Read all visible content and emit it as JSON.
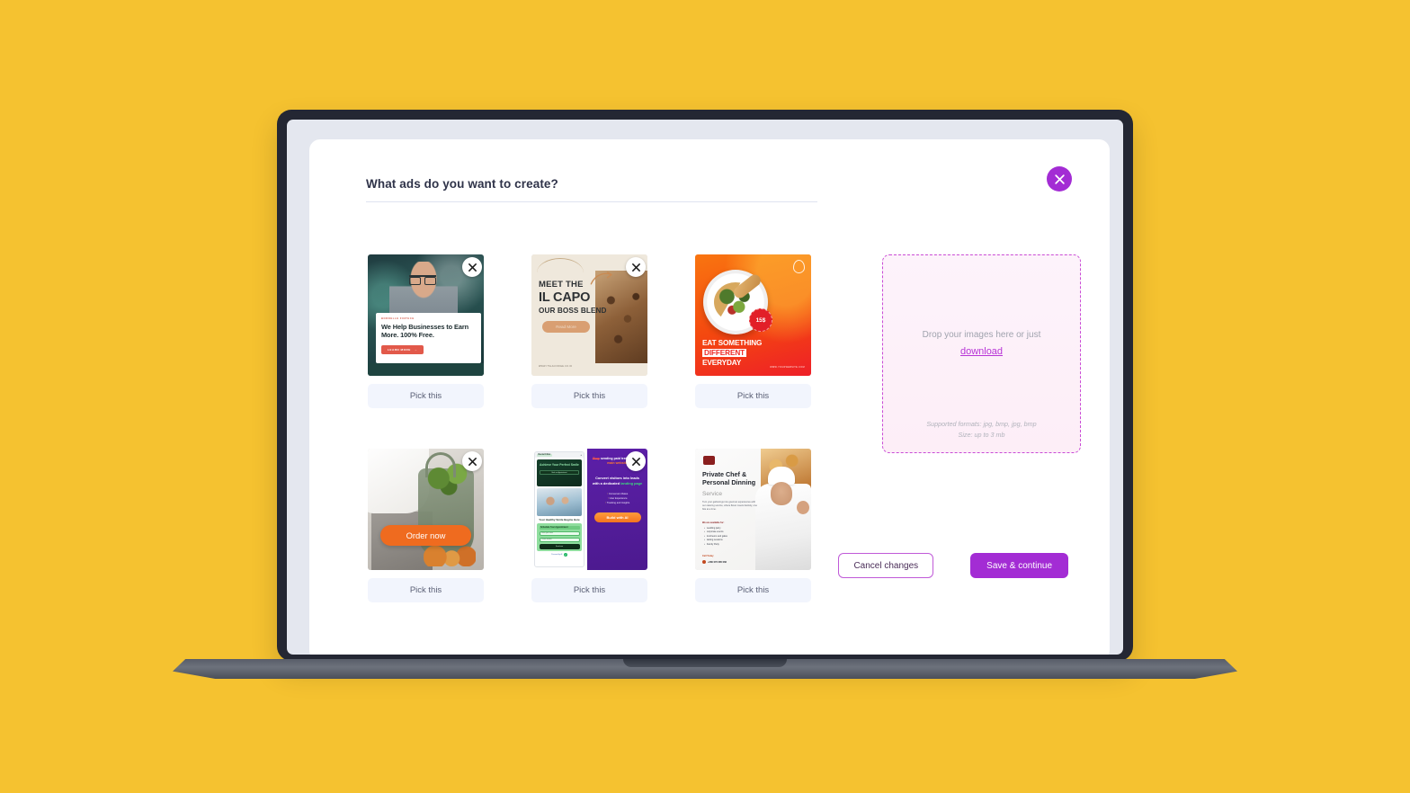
{
  "theme": {
    "page_background": "#f5c230",
    "accent_purple": "#a32cd4",
    "dropzone_border": "#c94bd6",
    "pick_button_bg": "#f2f5fd"
  },
  "modal": {
    "title": "What ads do you want to create?",
    "close_label": "×"
  },
  "ads": [
    {
      "id": "fintech",
      "pick_label": "Pick this",
      "remove_label": "×",
      "kicker": "BORDELLE FINTECH",
      "headline": "We Help Businesses to Earn More. 100% Free.",
      "cta": "LEARN MORE",
      "cta_arrow": "→"
    },
    {
      "id": "coffee",
      "pick_label": "Pick this",
      "remove_label": "×",
      "line1": "MEET THE",
      "line2": "IL CAPO",
      "line3": "OUR BOSS BLEND",
      "cta": "Read More",
      "url": "WWW.ITSLACOFFEE.CO.ID"
    },
    {
      "id": "food",
      "pick_label": "Pick this",
      "remove_label": "×",
      "badge": "15$",
      "line1": "EAT SOMETHING",
      "line2": "DIFFERENT",
      "line3": "EVERYDAY",
      "url": "WWW.YOURWEBSITE.COM"
    },
    {
      "id": "grocery",
      "pick_label": "Pick this",
      "remove_label": "×",
      "cta": "Order now"
    },
    {
      "id": "landing-page",
      "pick_label": "Pick this",
      "remove_label": "×",
      "phone": {
        "logo": "Dental Clinic",
        "menu": "≡",
        "hero_title": "Achieve Your Perfect Smile",
        "hero_button": "Book an Appointment",
        "subtitle": "Your Healthy Smile Begins Here",
        "form_title": "Schedule Your Appointment",
        "input_name": "Enter your name",
        "input_phone": "Phone number",
        "submit": "Send now",
        "powered": "Powered by AI"
      },
      "panel": {
        "head_a": "Stop",
        "head_b": " sending paid traffic to your ",
        "head_c": "main website",
        "sub_a": "Convert visitors into leads with a dedicated ",
        "sub_b": "landing page",
        "bullets": [
          "Conversion Rates",
          "User Experience",
          "Tracking and Insights"
        ],
        "cta": "Build with AI"
      }
    },
    {
      "id": "private-chef",
      "pick_label": "Pick this",
      "remove_label": "×",
      "title": "Private Chef & Personal Dinning",
      "subtitle": "Service",
      "description": "Turn your gatherings into gourmet experiences with our catering service, where flavor meets festivity, one bite at a time.",
      "available_label": "We are available for:",
      "bullets": [
        "wedding party",
        "corporate events",
        "luncheons and galas",
        "tasting sessions",
        "Family Party"
      ],
      "call_label": "Call Today",
      "phone": "+680 070 085 066"
    }
  ],
  "dropzone": {
    "hint": "Drop your images here or just",
    "link": "download",
    "formats": "Supported formats: jpg, bmp, jpg, bmp",
    "size": "Size: up to 3 mb"
  },
  "actions": {
    "cancel": "Cancel changes",
    "save": "Save & continue"
  }
}
